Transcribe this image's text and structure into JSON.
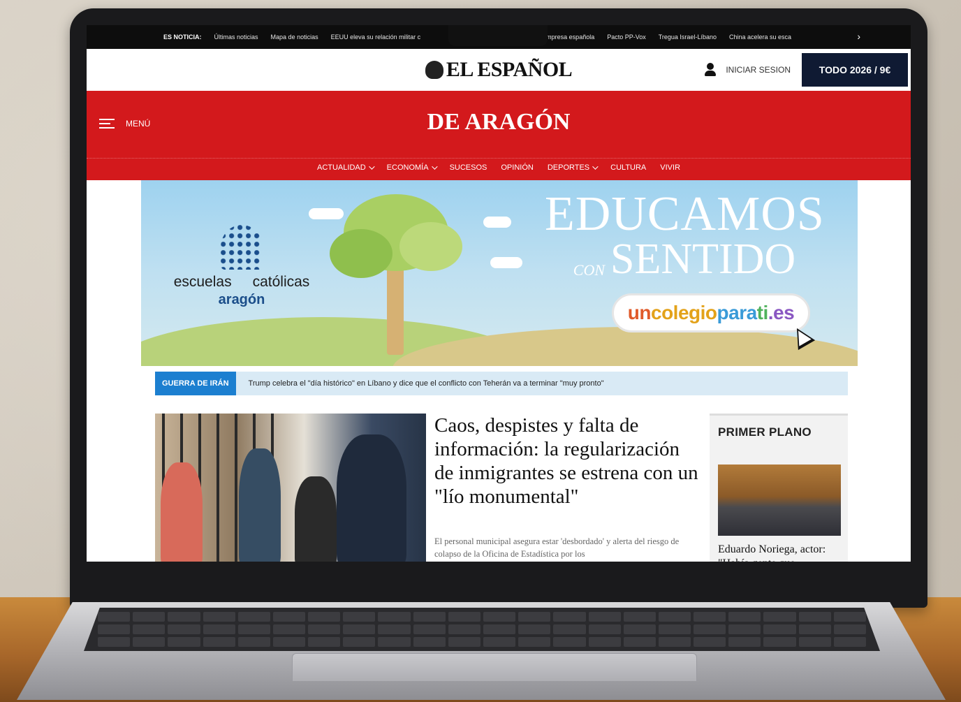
{
  "ticker": {
    "label": "ES NOTICIA:",
    "items": [
      "Últimas noticias",
      "Mapa de noticias",
      "EEUU eleva su relación militar c",
      "a una empresa española",
      "Pacto PP-Vox",
      "Tregua Israel-Líbano",
      "China acelera su esca"
    ]
  },
  "header": {
    "logo": "EL ESPAÑOL",
    "login_label": "INICIAR SESION",
    "subscribe_label": "TODO 2026 / 9€"
  },
  "section": {
    "menu_label": "MENÚ",
    "title": "DE ARAGÓN",
    "nav": [
      {
        "label": "ACTUALIDAD",
        "dropdown": true
      },
      {
        "label": "ECONOMÍA",
        "dropdown": true
      },
      {
        "label": "SUCESOS",
        "dropdown": false
      },
      {
        "label": "OPINIÓN",
        "dropdown": false
      },
      {
        "label": "DEPORTES",
        "dropdown": true
      },
      {
        "label": "CULTURA",
        "dropdown": false
      },
      {
        "label": "VIVIR",
        "dropdown": false
      }
    ]
  },
  "banner": {
    "brand_word1": "escuelas",
    "brand_word2": "católicas",
    "brand_region": "aragón",
    "title_line1": "EDUCAMOS",
    "title_con": "CON",
    "title_line2": "SENTIDO",
    "url_parts": [
      "un",
      "colegio",
      "para",
      "ti",
      ".es"
    ],
    "url_colors": [
      "#e05a2a",
      "#e3a21a",
      "#3a9bd8",
      "#4fb25c",
      "#8a57c2"
    ]
  },
  "breaking": {
    "tag": "GUERRA DE IRÁN",
    "text": "Trump celebra el \"día histórico\" en Líbano y dice que el conflicto con Teherán va a terminar \"muy pronto\""
  },
  "article": {
    "headline": "Caos, despistes y falta de información: la regularización de inmigrantes se estrena con un \"lío monumental\"",
    "lede": "El personal municipal asegura estar 'desbordado' y alerta del riesgo de colapso de la Oficina de Estadística por los"
  },
  "sidebar": {
    "title": "PRIMER PLANO",
    "caption": "Eduardo Noriega, actor: \"Había gente que"
  },
  "colors": {
    "brand_red": "#d3191c",
    "subscribe_bg": "#0f1a33",
    "breaking_tag": "#1c7fd0"
  }
}
